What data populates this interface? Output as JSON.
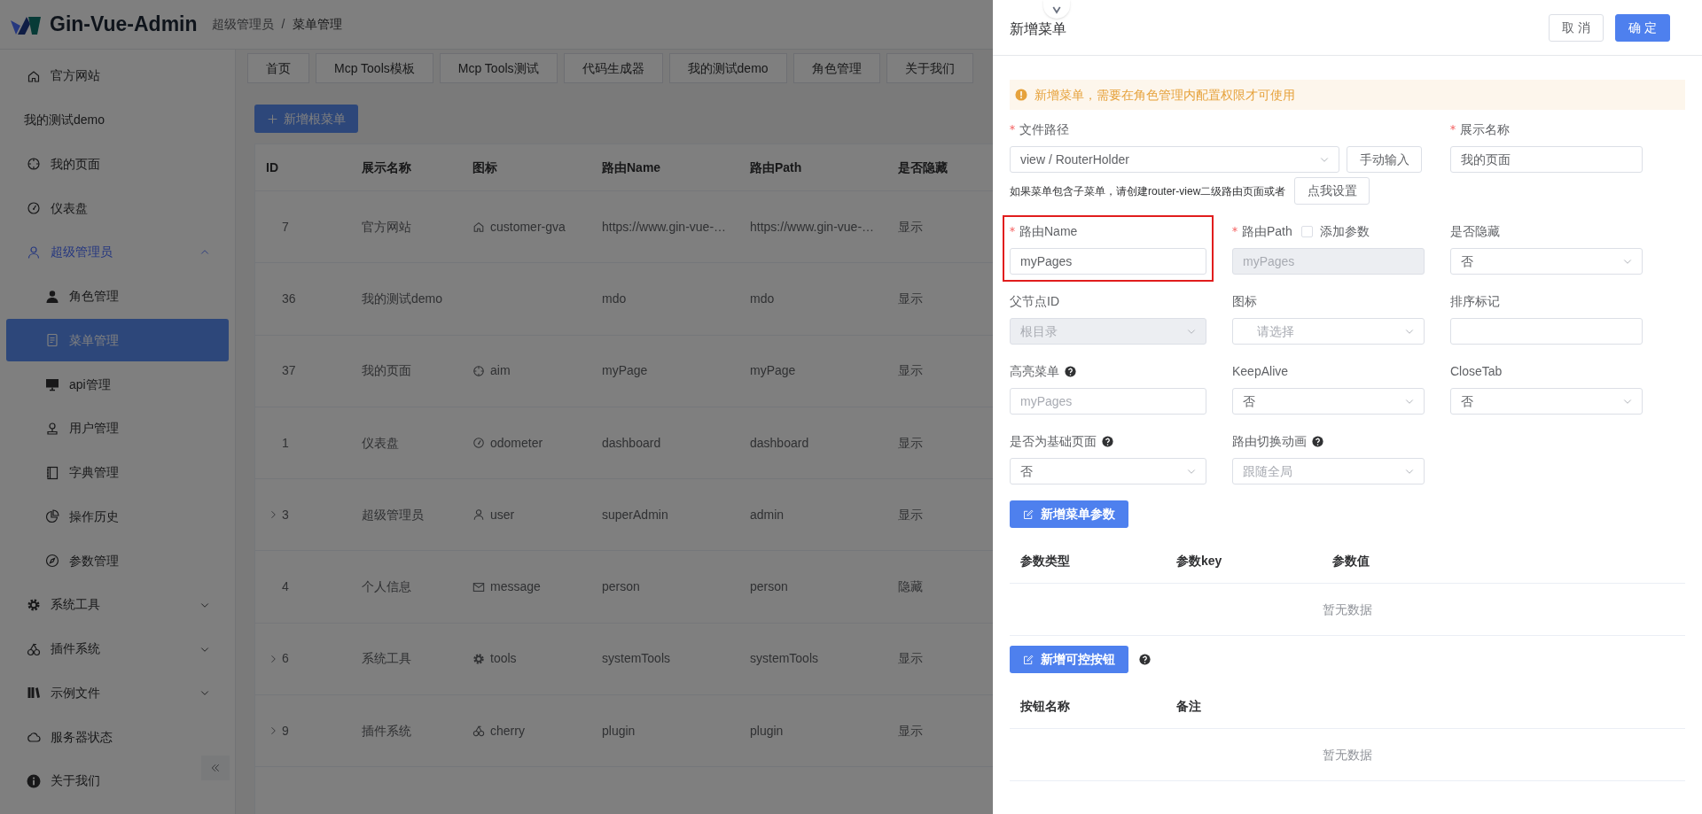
{
  "header": {
    "app_name": "Gin-Vue-Admin",
    "breadcrumb": [
      "超级管理员",
      "菜单管理"
    ],
    "separator": "/"
  },
  "sidebar": {
    "items": [
      {
        "kind": "item",
        "label": "官方网站",
        "selected": false
      },
      {
        "kind": "item",
        "label": "我的测试demo",
        "selected": false
      },
      {
        "kind": "item",
        "label": "我的页面",
        "selected": false
      },
      {
        "kind": "item",
        "label": "仪表盘",
        "selected": false
      },
      {
        "kind": "group",
        "label": "超级管理员",
        "selected": false,
        "expanded": true,
        "children": [
          {
            "kind": "item",
            "label": "角色管理",
            "selected": false
          },
          {
            "kind": "item",
            "label": "菜单管理",
            "selected": true
          },
          {
            "kind": "item",
            "label": "api管理",
            "selected": false
          },
          {
            "kind": "item",
            "label": "用户管理",
            "selected": false
          },
          {
            "kind": "item",
            "label": "字典管理",
            "selected": false
          },
          {
            "kind": "item",
            "label": "操作历史",
            "selected": false
          },
          {
            "kind": "item",
            "label": "参数管理",
            "selected": false
          }
        ]
      },
      {
        "kind": "group",
        "label": "系统工具",
        "selected": false,
        "expanded": false
      },
      {
        "kind": "group",
        "label": "插件系统",
        "selected": false,
        "expanded": false
      },
      {
        "kind": "group",
        "label": "示例文件",
        "selected": false,
        "expanded": false
      },
      {
        "kind": "item",
        "label": "服务器状态",
        "selected": false
      },
      {
        "kind": "item",
        "label": "关于我们",
        "selected": false
      }
    ]
  },
  "tabs": [
    "首页",
    "Mcp Tools模板",
    "Mcp Tools测试",
    "代码生成器",
    "我的测试demo",
    "角色管理",
    "关于我们"
  ],
  "add_root_button": "新增根菜单",
  "table": {
    "columns": [
      "ID",
      "展示名称",
      "图标",
      "路由Name",
      "路由Path",
      "是否隐藏"
    ],
    "rows": [
      {
        "id": "7",
        "name": "官方网站",
        "icon": "customer-gva",
        "route_name": "https://www.gin-vue-…",
        "route_path": "https://www.gin-vue-…",
        "visibility": "显示",
        "has_children": false
      },
      {
        "id": "36",
        "name": "我的测试demo",
        "route_name": "mdo",
        "route_path": "mdo",
        "visibility": "显示",
        "has_children": false
      },
      {
        "id": "37",
        "name": "我的页面",
        "icon": "aim",
        "route_name": "myPage",
        "route_path": "myPage",
        "visibility": "显示",
        "has_children": false
      },
      {
        "id": "1",
        "name": "仪表盘",
        "icon": "odometer",
        "route_name": "dashboard",
        "route_path": "dashboard",
        "visibility": "显示",
        "has_children": false
      },
      {
        "id": "3",
        "name": "超级管理员",
        "icon": "user",
        "route_name": "superAdmin",
        "route_path": "admin",
        "visibility": "显示",
        "has_children": true
      },
      {
        "id": "4",
        "name": "个人信息",
        "icon": "message",
        "route_name": "person",
        "route_path": "person",
        "visibility": "隐藏",
        "has_children": false
      },
      {
        "id": "6",
        "name": "系统工具",
        "icon": "tools",
        "route_name": "systemTools",
        "route_path": "systemTools",
        "visibility": "显示",
        "has_children": true
      },
      {
        "id": "9",
        "name": "插件系统",
        "icon": "cherry",
        "route_name": "plugin",
        "route_path": "plugin",
        "visibility": "显示",
        "has_children": true
      }
    ]
  },
  "drawer": {
    "title": "新增菜单",
    "buttons": [
      {
        "label": "取 消",
        "kind": "default"
      },
      {
        "label": "确 定",
        "kind": "primary"
      }
    ],
    "alert": "新增菜单，需要在角色管理内配置权限才可使用",
    "form": {
      "fields": [
        {
          "kind": "path-select",
          "label": "文件路径",
          "required": true,
          "help": false,
          "disabled": false,
          "highlighted": false,
          "value": "view / RouterHolder",
          "extra_button": "手动输入",
          "note": "如果菜单包含子菜单，请创建router-view二级路由页面或者",
          "note_button": "点我设置"
        },
        {
          "kind": "input",
          "label": "展示名称",
          "required": true,
          "help": false,
          "disabled": false,
          "highlighted": false,
          "value": "我的页面"
        },
        {
          "kind": "input",
          "label": "路由Name",
          "required": true,
          "help": false,
          "disabled": false,
          "highlighted": true,
          "value": "myPages"
        },
        {
          "kind": "input",
          "label": "路由Path",
          "required": true,
          "help": false,
          "disabled": true,
          "highlighted": false,
          "value": "myPages",
          "checkbox": {
            "label": "添加参数",
            "checked": false
          }
        },
        {
          "kind": "select",
          "label": "是否隐藏",
          "required": false,
          "help": false,
          "disabled": false,
          "highlighted": false,
          "value": "否"
        },
        {
          "kind": "select",
          "label": "父节点ID",
          "required": false,
          "help": false,
          "disabled": true,
          "highlighted": false,
          "value": "根目录"
        },
        {
          "kind": "select",
          "label": "图标",
          "required": false,
          "help": false,
          "disabled": false,
          "highlighted": false,
          "placeholder": "请选择"
        },
        {
          "kind": "input",
          "label": "排序标记",
          "required": false,
          "help": false,
          "disabled": false,
          "highlighted": false
        },
        {
          "kind": "input",
          "label": "高亮菜单",
          "required": false,
          "help": true,
          "disabled": false,
          "highlighted": false,
          "placeholder": "myPages"
        },
        {
          "kind": "select",
          "label": "KeepAlive",
          "required": false,
          "help": false,
          "disabled": false,
          "highlighted": false,
          "value": "否"
        },
        {
          "kind": "select",
          "label": "CloseTab",
          "required": false,
          "help": false,
          "disabled": false,
          "highlighted": false,
          "value": "否"
        },
        {
          "kind": "select",
          "label": "是否为基础页面",
          "required": false,
          "help": true,
          "disabled": false,
          "highlighted": false,
          "value": "否"
        },
        {
          "kind": "select",
          "label": "路由切换动画",
          "required": false,
          "help": true,
          "disabled": false,
          "highlighted": false,
          "placeholder": "跟随全局"
        }
      ]
    },
    "param_section": {
      "button": "新增菜单参数",
      "help": false,
      "columns": [
        "参数类型",
        "参数key",
        "参数值"
      ],
      "empty": "暂无数据"
    },
    "button_section": {
      "button": "新增可控按钮",
      "help": true,
      "columns": [
        "按钮名称",
        "备注"
      ],
      "empty": "暂无数据"
    }
  }
}
